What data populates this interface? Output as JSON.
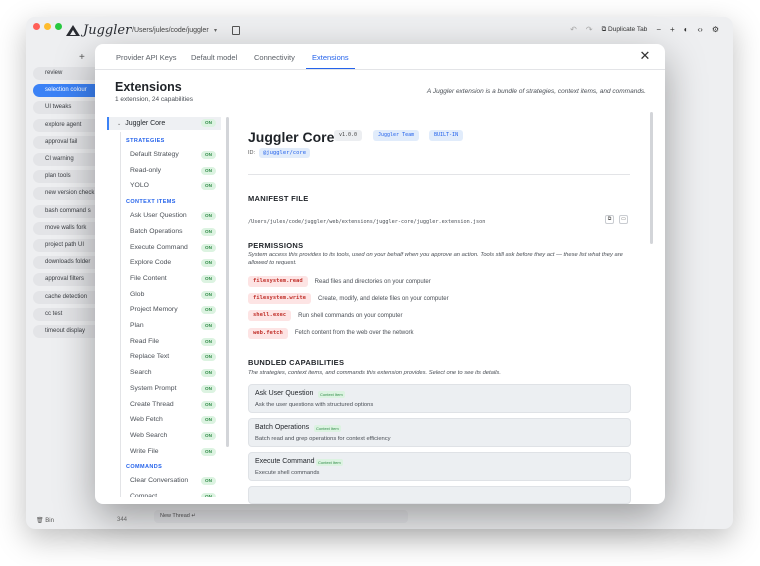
{
  "app": {
    "logo_name": "Juggler",
    "path": "/Users/jules/code/juggler",
    "duplicate_tab": "Duplicate Tab",
    "traffic_colors": [
      "#ff5f57",
      "#febc2e",
      "#28c840"
    ],
    "sidebar_items": [
      "review",
      "selection colour",
      "UI tweaks",
      "explore agent",
      "approval fail",
      "CI warning",
      "plan tools",
      "new version check",
      "bash command s",
      "move walls fork",
      "project path UI",
      "downloads folder",
      "approval filters",
      "cache detection",
      "cc test",
      "timeout display"
    ],
    "sidebar_active_index": 1,
    "footer_label": "Bin",
    "footer_count": "344",
    "composer_placeholder": "New Thread"
  },
  "modal": {
    "tabs": [
      "Provider API Keys",
      "Default model",
      "Connectivity",
      "Extensions"
    ],
    "active_tab_index": 3,
    "title": "Extensions",
    "subtitle": "1 extension, 24 capabilities",
    "description": "A Juggler extension is a bundle of strategies, context items, and commands.",
    "tree": {
      "root_label": "Juggler Core",
      "on_label": "ON",
      "sections": [
        {
          "label": "STRATEGIES",
          "items": [
            "Default Strategy",
            "Read-only",
            "YOLO"
          ]
        },
        {
          "label": "CONTEXT ITEMS",
          "items": [
            "Ask User Question",
            "Batch Operations",
            "Execute Command",
            "Explore Code",
            "File Content",
            "Glob",
            "Project Memory",
            "Plan",
            "Read File",
            "Replace Text",
            "Search",
            "System Prompt",
            "Create Thread",
            "Web Fetch",
            "Web Search",
            "Write File"
          ]
        },
        {
          "label": "COMMANDS",
          "items": [
            "Clear Conversation",
            "Compact"
          ]
        }
      ]
    },
    "detail": {
      "name": "Juggler Core",
      "version": "v1.0.0",
      "author": "Juggler Team",
      "kind": "BUILT-IN",
      "id_label": "ID:",
      "id_value": "@juggler/core",
      "manifest_heading": "MANIFEST FILE",
      "manifest_path": "/Users/jules/code/juggler/web/extensions/juggler-core/juggler.extension.json",
      "permissions_heading": "PERMISSIONS",
      "permissions_desc": "System access this provides to its tools, used on your behalf when you approve an action. Tools still ask before they act — these list what they are allowed to request.",
      "permissions": [
        {
          "code": "filesystem.read",
          "desc": "Read files and directories on your computer"
        },
        {
          "code": "filesystem.write",
          "desc": "Create, modify, and delete files on your computer"
        },
        {
          "code": "shell.exec",
          "desc": "Run shell commands on your computer"
        },
        {
          "code": "web.fetch",
          "desc": "Fetch content from the web over the network"
        }
      ],
      "capabilities_heading": "BUNDLED CAPABILITIES",
      "capabilities_desc": "The strategies, context items, and commands this extension provides. Select one to see its details.",
      "capabilities": [
        {
          "name": "Ask User Question",
          "tag": "Context Item",
          "desc": "Ask the user questions with structured options"
        },
        {
          "name": "Batch Operations",
          "tag": "Context Item",
          "desc": "Batch read and grep operations for context efficiency"
        },
        {
          "name": "Execute Command",
          "tag": "Context Item",
          "desc": "Execute shell commands"
        }
      ]
    }
  }
}
